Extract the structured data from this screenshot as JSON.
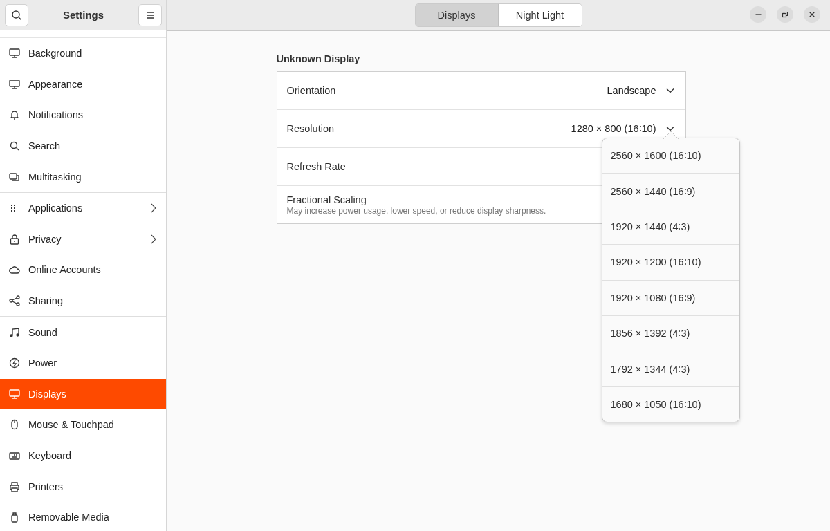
{
  "sidebar": {
    "title": "Settings",
    "groups": [
      [
        {
          "label": "Background",
          "selected": false,
          "submenu": false
        },
        {
          "label": "Appearance",
          "selected": false,
          "submenu": false
        },
        {
          "label": "Notifications",
          "selected": false,
          "submenu": false
        },
        {
          "label": "Search",
          "selected": false,
          "submenu": false
        },
        {
          "label": "Multitasking",
          "selected": false,
          "submenu": false
        }
      ],
      [
        {
          "label": "Applications",
          "selected": false,
          "submenu": true
        },
        {
          "label": "Privacy",
          "selected": false,
          "submenu": true
        },
        {
          "label": "Online Accounts",
          "selected": false,
          "submenu": false
        },
        {
          "label": "Sharing",
          "selected": false,
          "submenu": false
        }
      ],
      [
        {
          "label": "Sound",
          "selected": false,
          "submenu": false
        },
        {
          "label": "Power",
          "selected": false,
          "submenu": false
        },
        {
          "label": "Displays",
          "selected": true,
          "submenu": false
        },
        {
          "label": "Mouse & Touchpad",
          "selected": false,
          "submenu": false
        },
        {
          "label": "Keyboard",
          "selected": false,
          "submenu": false
        },
        {
          "label": "Printers",
          "selected": false,
          "submenu": false
        },
        {
          "label": "Removable Media",
          "selected": false,
          "submenu": false
        }
      ]
    ]
  },
  "tabs": [
    {
      "label": "Displays",
      "selected": true
    },
    {
      "label": "Night Light",
      "selected": false
    }
  ],
  "section_title": "Unknown Display",
  "rows": [
    {
      "label": "Orientation",
      "value": "Landscape",
      "dropdown": true
    },
    {
      "label": "Resolution",
      "value": "1280 × 800 (16∶10)",
      "dropdown": true
    },
    {
      "label": "Refresh Rate"
    },
    {
      "label": "Fractional Scaling",
      "subtitle": "May increase power usage, lower speed, or reduce display sharpness."
    }
  ],
  "resolution_popover": [
    "2560 × 1600 (16∶10)",
    "2560 × 1440 (16∶9)",
    "1920 × 1440 (4∶3)",
    "1920 × 1200 (16∶10)",
    "1920 × 1080 (16∶9)",
    "1856 × 1392 (4∶3)",
    "1792 × 1344 (4∶3)",
    "1680 × 1050 (16∶10)"
  ]
}
